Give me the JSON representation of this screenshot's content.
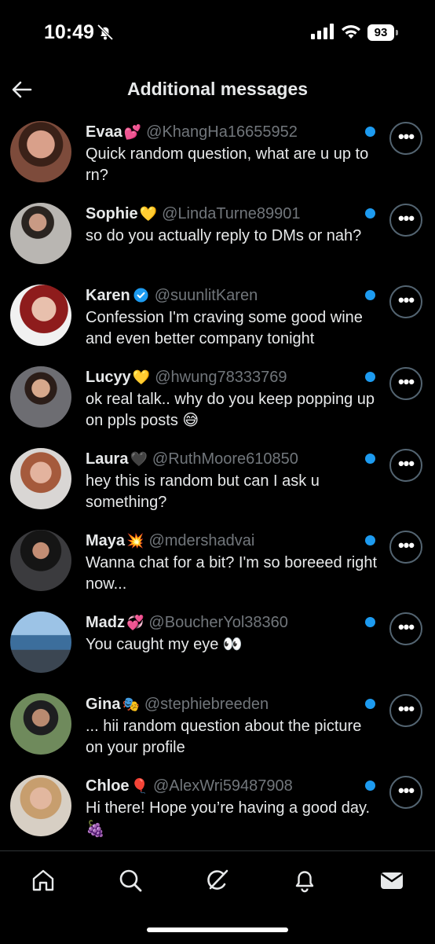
{
  "status_bar": {
    "time": "10:49",
    "battery": "93",
    "icons": [
      "bell-slash-icon",
      "signal-icon",
      "wifi-icon",
      "battery-icon"
    ]
  },
  "header": {
    "title": "Additional messages",
    "back_icon": "arrow-left-icon"
  },
  "colors": {
    "background": "#000000",
    "text": "#e7e9ea",
    "handle": "#71767b",
    "unread_dot": "#1d9bf0",
    "border": "#536471"
  },
  "conversations": [
    {
      "name": "Evaa",
      "emoji": "💕",
      "handle": "@KhangHa16655952",
      "message": "Quick random question, what are u up to rn?",
      "unread": true,
      "verified": false
    },
    {
      "name": "Sophie",
      "emoji": "💛",
      "handle": "@LindaTurne89901",
      "message": "so do you actually reply to DMs or nah?",
      "unread": true,
      "verified": false
    },
    {
      "name": "Karen",
      "emoji": "",
      "handle": "@suunlitKaren",
      "message": "Confession I'm craving some good wine and even better company tonight",
      "unread": true,
      "verified": true
    },
    {
      "name": "Lucyy",
      "emoji": "💛",
      "handle": "@hwung78333769",
      "message": "ok real talk.. why do you keep popping up on ppls posts 😅",
      "unread": true,
      "verified": false
    },
    {
      "name": "Laura",
      "emoji": "🖤",
      "handle": "@RuthMoore610850",
      "message": "hey this is random but can I ask u something?",
      "unread": true,
      "verified": false
    },
    {
      "name": "Maya",
      "emoji": "💥",
      "handle": "@mdershadvai",
      "message": "Wanna chat for a bit? I'm so boreeed right now...",
      "unread": true,
      "verified": false
    },
    {
      "name": "Madz",
      "emoji": "💞",
      "handle": "@BoucherYol38360",
      "message": "You caught my eye 👀",
      "unread": true,
      "verified": false
    },
    {
      "name": "Gina",
      "emoji": "🎭",
      "handle": "@stephiebreeden",
      "message": "... hii random question about the picture on your profile",
      "unread": true,
      "verified": false
    },
    {
      "name": "Chloe",
      "emoji": "🎈",
      "handle": "@AlexWri59487908",
      "message": "Hi there! Hope you’re having a good day. 🍇",
      "unread": true,
      "verified": false
    }
  ],
  "more_button_label": "•••",
  "tabbar": {
    "items": [
      "home-icon",
      "search-icon",
      "grok-icon",
      "notifications-icon",
      "messages-icon"
    ]
  }
}
